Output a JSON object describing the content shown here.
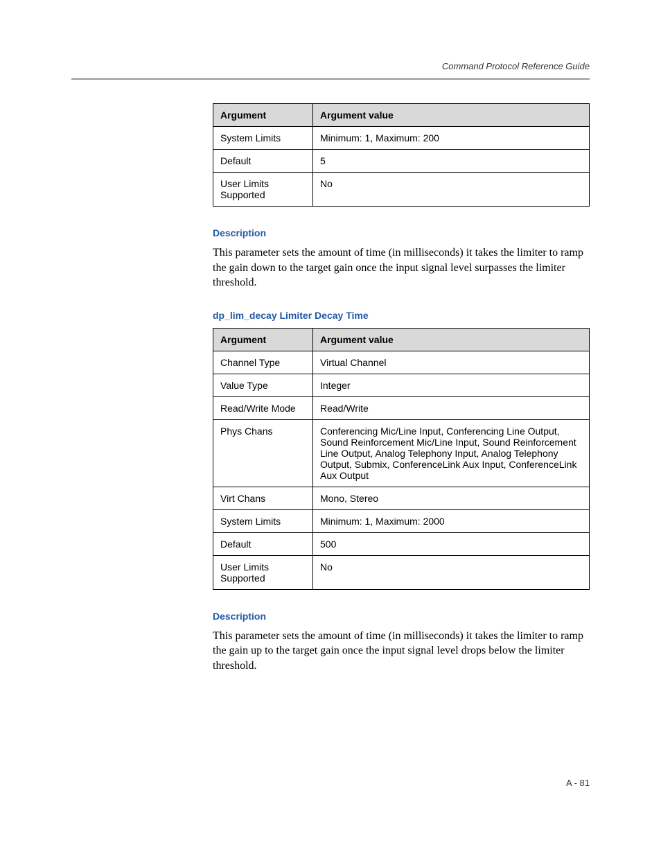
{
  "header": {
    "title": "Command Protocol Reference Guide"
  },
  "table1": {
    "head": {
      "argument": "Argument",
      "value": "Argument value"
    },
    "rows": [
      {
        "argument": "System Limits",
        "value": "Minimum: 1, Maximum: 200"
      },
      {
        "argument": "Default",
        "value": "5"
      },
      {
        "argument": "User Limits Supported",
        "value": "No"
      }
    ]
  },
  "section1": {
    "heading": "Description",
    "text": "This parameter sets the amount of time (in milliseconds) it takes the limiter to ramp the gain down to the target gain once the input signal level surpasses the limiter threshold."
  },
  "section2": {
    "heading": "dp_lim_decay Limiter Decay Time"
  },
  "table2": {
    "head": {
      "argument": "Argument",
      "value": "Argument value"
    },
    "rows": [
      {
        "argument": "Channel Type",
        "value": "Virtual Channel"
      },
      {
        "argument": "Value Type",
        "value": "Integer"
      },
      {
        "argument": "Read/Write Mode",
        "value": "Read/Write"
      },
      {
        "argument": "Phys Chans",
        "value": "Conferencing Mic/Line Input, Conferencing Line Output, Sound Reinforcement Mic/Line Input, Sound Reinforcement Line Output, Analog Telephony Input, Analog Telephony Output, Submix, ConferenceLink Aux Input, ConferenceLink Aux Output"
      },
      {
        "argument": "Virt Chans",
        "value": "Mono, Stereo"
      },
      {
        "argument": "System Limits",
        "value": "Minimum: 1, Maximum: 2000"
      },
      {
        "argument": "Default",
        "value": "500"
      },
      {
        "argument": "User Limits Supported",
        "value": "No"
      }
    ]
  },
  "section3": {
    "heading": "Description",
    "text": "This parameter sets the amount of time (in milliseconds) it takes the limiter to ramp the gain up to the target gain once the input signal level drops below the limiter threshold."
  },
  "footer": {
    "page": "A - 81"
  }
}
